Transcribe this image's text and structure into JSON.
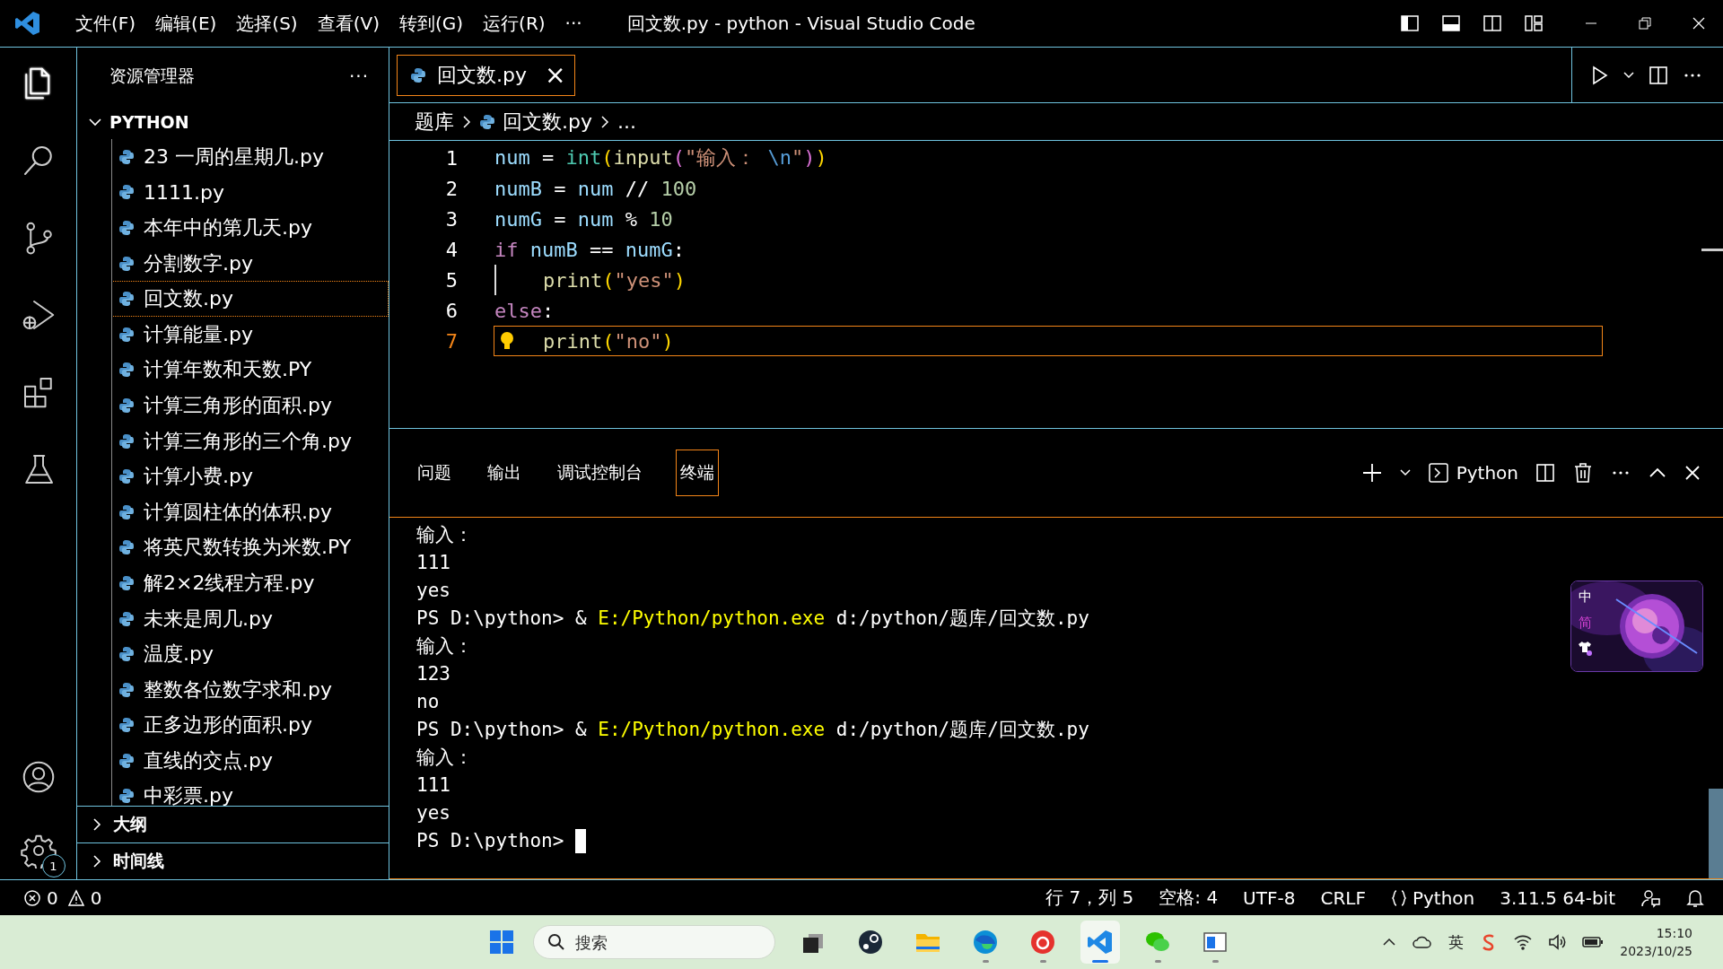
{
  "title_bar": {
    "menus": [
      "文件(F)",
      "编辑(E)",
      "选择(S)",
      "查看(V)",
      "转到(G)",
      "运行(R)"
    ],
    "more": "···",
    "title": "回文数.py - python - Visual Studio Code"
  },
  "activity_bar": {
    "items": [
      {
        "kind": "files",
        "selected": true
      },
      {
        "kind": "search",
        "selected": false
      },
      {
        "kind": "source-control",
        "selected": false
      },
      {
        "kind": "run-debug",
        "selected": false
      },
      {
        "kind": "extensions",
        "selected": false
      },
      {
        "kind": "testing",
        "selected": false
      }
    ],
    "account": {
      "kind": "account"
    },
    "settings": {
      "kind": "settings",
      "badge": "1"
    }
  },
  "sidebar": {
    "title": "资源管理器",
    "more": "···",
    "folder": {
      "name": "PYTHON",
      "expanded": true,
      "files": [
        {
          "name": "23 一周的星期几.py",
          "selected": false
        },
        {
          "name": "1111.py",
          "selected": false
        },
        {
          "name": "本年中的第几天.py",
          "selected": false
        },
        {
          "name": "分割数字.py",
          "selected": false
        },
        {
          "name": "回文数.py",
          "selected": true
        },
        {
          "name": "计算能量.py",
          "selected": false
        },
        {
          "name": "计算年数和天数.PY",
          "selected": false
        },
        {
          "name": "计算三角形的面积.py",
          "selected": false
        },
        {
          "name": "计算三角形的三个角.py",
          "selected": false
        },
        {
          "name": "计算小费.py",
          "selected": false
        },
        {
          "name": "计算圆柱体的体积.py",
          "selected": false
        },
        {
          "name": "将英尺数转换为米数.PY",
          "selected": false
        },
        {
          "name": "解2×2线程方程.py",
          "selected": false
        },
        {
          "name": "未来是周几.py",
          "selected": false
        },
        {
          "name": "温度.py",
          "selected": false
        },
        {
          "name": "整数各位数字求和.py",
          "selected": false
        },
        {
          "name": "正多边形的面积.py",
          "selected": false
        },
        {
          "name": "直线的交点.py",
          "selected": false
        },
        {
          "name": "中彩票.py",
          "selected": false
        }
      ]
    },
    "sections": [
      {
        "name": "大纲",
        "expanded": false
      },
      {
        "name": "时间线",
        "expanded": false
      }
    ]
  },
  "editor": {
    "tabs": [
      {
        "label": "回文数.py",
        "selected": true,
        "close": "×"
      }
    ],
    "breadcrumb": [
      "题库",
      "回文数.py",
      "..."
    ],
    "lines": [
      {
        "number": "1",
        "current": false,
        "indent": false,
        "lightbulb": false,
        "tokens": [
          {
            "text": "num",
            "kind": "var"
          },
          {
            "text": " = ",
            "kind": "op"
          },
          {
            "text": "int",
            "kind": "builtin"
          },
          {
            "text": "(",
            "kind": "paren1"
          },
          {
            "text": "input",
            "kind": "func"
          },
          {
            "text": "(",
            "kind": "paren2"
          },
          {
            "text": "\"输入：",
            "kind": "str"
          },
          {
            "text": " \\n",
            "kind": "esc"
          },
          {
            "text": "\"",
            "kind": "str"
          },
          {
            "text": ")",
            "kind": "paren2"
          },
          {
            "text": ")",
            "kind": "paren1"
          }
        ]
      },
      {
        "number": "2",
        "current": false,
        "indent": false,
        "lightbulb": false,
        "tokens": [
          {
            "text": "numB",
            "kind": "var"
          },
          {
            "text": " = ",
            "kind": "op"
          },
          {
            "text": "num",
            "kind": "var"
          },
          {
            "text": " // ",
            "kind": "op"
          },
          {
            "text": "100",
            "kind": "number"
          }
        ]
      },
      {
        "number": "3",
        "current": false,
        "indent": false,
        "lightbulb": false,
        "tokens": [
          {
            "text": "numG",
            "kind": "var"
          },
          {
            "text": " = ",
            "kind": "op"
          },
          {
            "text": "num",
            "kind": "var"
          },
          {
            "text": " % ",
            "kind": "op"
          },
          {
            "text": "10",
            "kind": "number"
          }
        ]
      },
      {
        "number": "4",
        "current": false,
        "indent": false,
        "lightbulb": false,
        "tokens": [
          {
            "text": "if ",
            "kind": "kw"
          },
          {
            "text": "numB",
            "kind": "var"
          },
          {
            "text": " == ",
            "kind": "op"
          },
          {
            "text": "numG",
            "kind": "var"
          },
          {
            "text": ":",
            "kind": "op"
          }
        ]
      },
      {
        "number": "5",
        "current": false,
        "indent": true,
        "lightbulb": false,
        "tokens": [
          {
            "text": "print",
            "kind": "func"
          },
          {
            "text": "(",
            "kind": "paren1"
          },
          {
            "text": "\"yes\"",
            "kind": "str"
          },
          {
            "text": ")",
            "kind": "paren1"
          }
        ]
      },
      {
        "number": "6",
        "current": false,
        "indent": false,
        "lightbulb": false,
        "tokens": [
          {
            "text": "else",
            "kind": "kw"
          },
          {
            "text": ":",
            "kind": "op"
          }
        ]
      },
      {
        "number": "7",
        "current": true,
        "indent": true,
        "lightbulb": true,
        "tokens": [
          {
            "text": "print",
            "kind": "func"
          },
          {
            "text": "(",
            "kind": "paren1"
          },
          {
            "text": "\"no\"",
            "kind": "str"
          },
          {
            "text": ")",
            "kind": "paren1"
          }
        ]
      }
    ]
  },
  "panel": {
    "tabs": [
      {
        "label": "问题",
        "selected": false
      },
      {
        "label": "输出",
        "selected": false
      },
      {
        "label": "调试控制台",
        "selected": false
      },
      {
        "label": "终端",
        "selected": true
      }
    ],
    "terminal_name": "Python",
    "terminal": [
      [
        {
          "text": "输入：",
          "kind": "plain"
        }
      ],
      [
        {
          "text": "111",
          "kind": "plain"
        }
      ],
      [
        {
          "text": "yes",
          "kind": "plain"
        }
      ],
      [
        {
          "text": "PS D:\\python> & ",
          "kind": "plain"
        },
        {
          "text": "E:/Python/python.exe",
          "kind": "path"
        },
        {
          "text": " d:/python/题库/回文数.py",
          "kind": "plain"
        }
      ],
      [
        {
          "text": "输入：",
          "kind": "plain"
        }
      ],
      [
        {
          "text": "123",
          "kind": "plain"
        }
      ],
      [
        {
          "text": "no",
          "kind": "plain"
        }
      ],
      [
        {
          "text": "PS D:\\python> & ",
          "kind": "plain"
        },
        {
          "text": "E:/Python/python.exe",
          "kind": "path"
        },
        {
          "text": " d:/python/题库/回文数.py",
          "kind": "plain"
        }
      ],
      [
        {
          "text": "输入：",
          "kind": "plain"
        }
      ],
      [
        {
          "text": "111",
          "kind": "plain"
        }
      ],
      [
        {
          "text": "yes",
          "kind": "plain"
        }
      ],
      [
        {
          "text": "PS D:\\python> ",
          "kind": "plain"
        }
      ]
    ],
    "ime": {
      "mode": "中",
      "script": "简"
    }
  },
  "status_bar": {
    "errors": "0",
    "warnings": "0",
    "items": [
      {
        "kind": "text",
        "label": "行 7，列 5"
      },
      {
        "kind": "text",
        "label": "空格: 4"
      },
      {
        "kind": "text",
        "label": "UTF-8"
      },
      {
        "kind": "text",
        "label": "CRLF"
      },
      {
        "kind": "language",
        "label": "Python"
      },
      {
        "kind": "text",
        "label": "3.11.5 64-bit"
      }
    ]
  },
  "taskbar": {
    "search": {
      "placeholder": "搜索"
    },
    "apps": [
      {
        "kind": "taskview",
        "running": false,
        "selected": false
      },
      {
        "kind": "steam",
        "running": false,
        "selected": false
      },
      {
        "kind": "folder",
        "running": false,
        "selected": false
      },
      {
        "kind": "browser",
        "running": true,
        "selected": false
      },
      {
        "kind": "music",
        "running": true,
        "selected": false
      },
      {
        "kind": "code",
        "running": true,
        "selected": true
      },
      {
        "kind": "chat",
        "running": true,
        "selected": false
      },
      {
        "kind": "window",
        "running": true,
        "selected": false
      }
    ],
    "ime": "英",
    "time": "15:10",
    "date": "2023/10/25"
  }
}
